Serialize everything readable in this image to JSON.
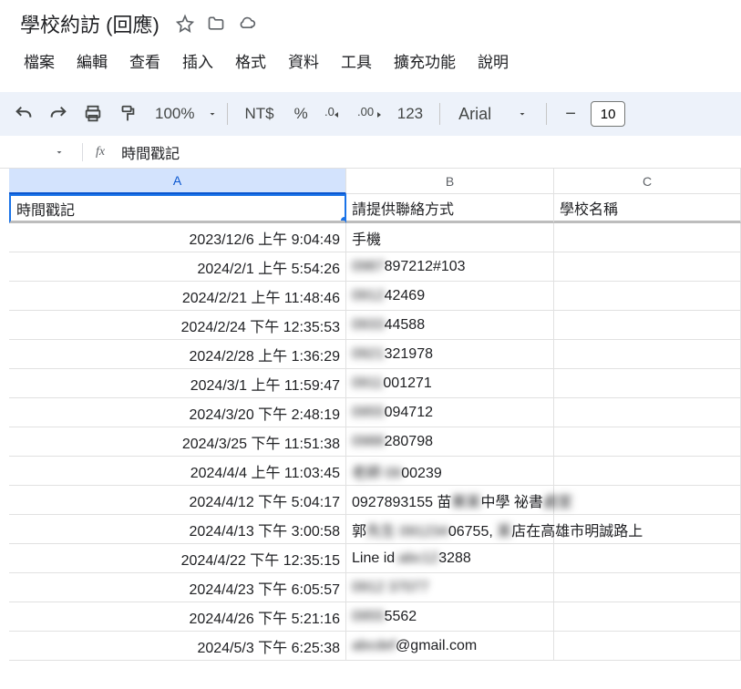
{
  "doc_title": "學校約訪 (回應)",
  "menu": [
    "檔案",
    "編輯",
    "查看",
    "插入",
    "格式",
    "資料",
    "工具",
    "擴充功能",
    "說明"
  ],
  "toolbar": {
    "zoom": "100%",
    "currency": "NT$",
    "percent": "%",
    "dec_dec": ".0",
    "dec_inc": ".00",
    "num123": "123",
    "font": "Arial",
    "fontsize": "10",
    "minus": "−"
  },
  "formula_bar": "時間戳記",
  "columns": [
    "A",
    "B",
    "C"
  ],
  "headers": {
    "a": "時間戳記",
    "b": "請提供聯絡方式",
    "c": "學校名稱"
  },
  "rows": [
    {
      "a": "2023/12/6 上午 9:04:49",
      "b": "手機",
      "c": ""
    },
    {
      "a": "2024/2/1 上午 5:54:26",
      "b_prefix": "",
      "b_blur": "0987",
      "b_suffix": "897212#103",
      "c": ""
    },
    {
      "a": "2024/2/21 上午 11:48:46",
      "b_prefix": "",
      "b_blur": "0912",
      "b_suffix": "42469",
      "c": ""
    },
    {
      "a": "2024/2/24 下午 12:35:53",
      "b_prefix": "",
      "b_blur": "0933",
      "b_suffix": "44588",
      "c": ""
    },
    {
      "a": "2024/2/28 上午 1:36:29",
      "b_prefix": "",
      "b_blur": "0921",
      "b_suffix": "321978",
      "c": ""
    },
    {
      "a": "2024/3/1 上午 11:59:47",
      "b_prefix": "",
      "b_blur": "0911",
      "b_suffix": "001271",
      "c": ""
    },
    {
      "a": "2024/3/20 下午 2:48:19",
      "b_prefix": "",
      "b_blur": "0955",
      "b_suffix": "094712",
      "c": ""
    },
    {
      "a": "2024/3/25 下午 11:51:38",
      "b_prefix": "",
      "b_blur": "0988",
      "b_suffix": "280798",
      "c": ""
    },
    {
      "a": "2024/4/4 上午 11:03:45",
      "b_prefix": "",
      "b_blur": "老師 09",
      "b_suffix": "00239",
      "c": ""
    },
    {
      "a": "2024/4/12 下午 5:04:17",
      "b_prefix": "0927893155 苗",
      "b_blur": "栗某",
      "b_suffix": "中學 祕書",
      "b_blur2": "處室",
      "c": ""
    },
    {
      "a": "2024/4/13 下午 3:00:58",
      "b_prefix": "郭",
      "b_blur": "先生 091234",
      "b_suffix": "06755, ",
      "b_blur2": "某",
      "b_suffix2": "店在高雄市明誠路上",
      "c": ""
    },
    {
      "a": "2024/4/22 下午 12:35:15",
      "b_prefix": "Line id",
      "b_blur": ":abc12",
      "b_suffix": "3288",
      "c": ""
    },
    {
      "a": "2024/4/23 下午 6:05:57",
      "b_prefix": "",
      "b_blur": "0912 37077",
      "b_suffix": "",
      "c": ""
    },
    {
      "a": "2024/4/26 下午 5:21:16",
      "b_prefix": "",
      "b_blur": "0955",
      "b_suffix": "5562",
      "c": ""
    },
    {
      "a": "2024/5/3 下午 6:25:38",
      "b_prefix": "",
      "b_blur": "abcdef",
      "b_suffix": "@gmail.com",
      "c": ""
    }
  ]
}
